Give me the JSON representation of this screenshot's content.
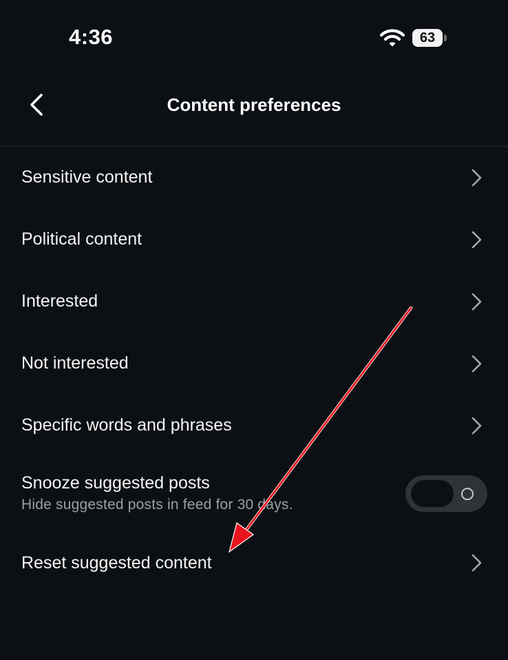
{
  "status_bar": {
    "time": "4:36",
    "battery_level": "63"
  },
  "header": {
    "title": "Content preferences"
  },
  "settings": {
    "items": [
      {
        "label": "Sensitive content"
      },
      {
        "label": "Political content"
      },
      {
        "label": "Interested"
      },
      {
        "label": "Not interested"
      },
      {
        "label": "Specific words and phrases"
      }
    ],
    "snooze": {
      "label": "Snooze suggested posts",
      "description": "Hide suggested posts in feed for 30 days.",
      "enabled": false
    },
    "reset": {
      "label": "Reset suggested content"
    }
  },
  "colors": {
    "background": "#0c1014",
    "text": "#f5f5f5",
    "subtext": "#9aa0a6",
    "annotation_arrow": "#e8141e"
  },
  "icons": [
    "wifi-icon",
    "battery-icon",
    "back-arrow-icon",
    "chevron-right-icon",
    "toggle-off-indicator-icon"
  ]
}
